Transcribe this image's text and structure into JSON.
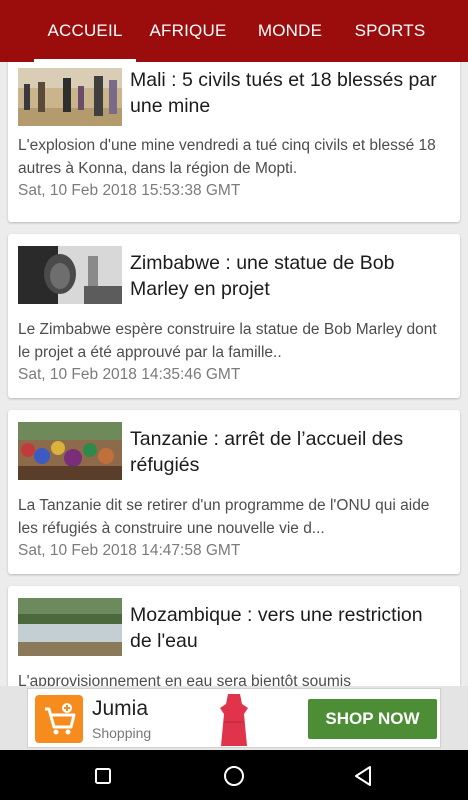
{
  "tabs": [
    {
      "label": "ACCUEIL",
      "active": true
    },
    {
      "label": "AFRIQUE",
      "active": false
    },
    {
      "label": "MONDE",
      "active": false
    },
    {
      "label": "SPORTS",
      "active": false
    }
  ],
  "articles": [
    {
      "title": "Mali : 5 civils tués et 18 blessés par une mine",
      "description": "L'explosion d'une mine vendredi a tué cinq civils et blessé 18 autres à Konna, dans la région de Mopti.",
      "date": "Sat, 10 Feb 2018 15:53:38 GMT",
      "image_icon": "desert-people-photo-icon"
    },
    {
      "title": "Zimbabwe : une statue de Bob Marley en projet",
      "description": "Le Zimbabwe espère construire la statue de Bob Marley dont le projet a été approuvé par la famille..",
      "date": "Sat, 10 Feb 2018 14:35:46 GMT",
      "image_icon": "singer-portrait-photo-icon"
    },
    {
      "title": "Tanzanie : arrêt de l’accueil des réfugiés",
      "description": "La Tanzanie dit se retirer d'un programme de l'ONU qui aide les réfugiés à construire une nouvelle vie d...",
      "date": "Sat, 10 Feb 2018 14:47:58 GMT",
      "image_icon": "refugee-crowd-photo-icon"
    },
    {
      "title": "Mozambique : vers une restriction de l'eau",
      "description": "L'approvisionnement en eau sera bientôt soumis",
      "date": "",
      "image_icon": "river-landscape-photo-icon"
    }
  ],
  "ad": {
    "brand": "Jumia",
    "subtitle": "Shopping",
    "cta": "SHOP NOW",
    "logo_icon": "shopping-cart-icon",
    "product_icon": "red-dress-icon"
  },
  "colors": {
    "header": "#9b0d0d",
    "cta": "#4c8d35",
    "ad_logo": "#f68b1e"
  },
  "navbar": {
    "icons": [
      "recent-apps-icon",
      "home-circle-icon",
      "back-triangle-icon"
    ]
  }
}
